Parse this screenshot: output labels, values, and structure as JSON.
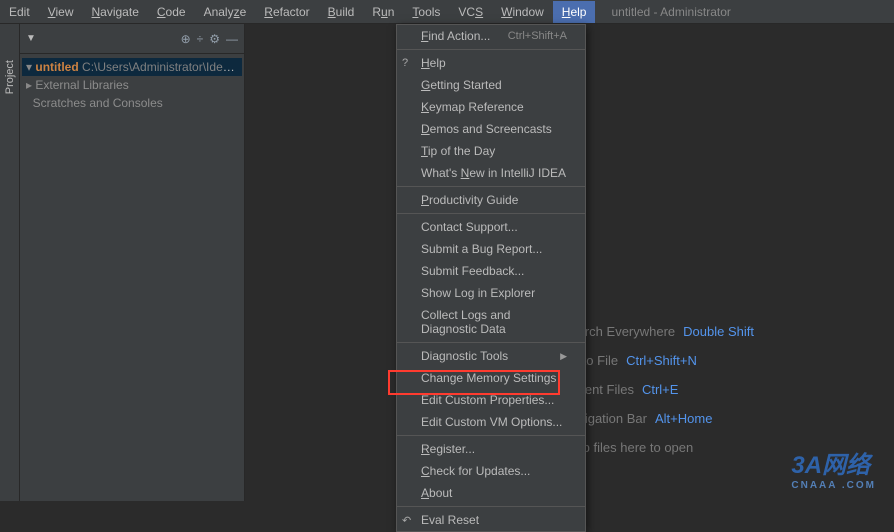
{
  "window_title": "untitled - Administrator",
  "menubar": {
    "edit": "Edit",
    "view": "View",
    "navigate": "Navigate",
    "code": "Code",
    "analyze": "Analyze",
    "refactor": "Refactor",
    "build": "Build",
    "run": "Run",
    "tools": "Tools",
    "vcs": "VCS",
    "window": "Window",
    "help": "Help"
  },
  "side_tab": "Project",
  "project": {
    "name": "untitled",
    "path": "C:\\Users\\Administrator\\IdeaProjects\\untitled",
    "ext_libs": "External Libraries",
    "scratches": "Scratches and Consoles"
  },
  "help_menu": {
    "find_action": "Find Action...",
    "find_action_sc": "Ctrl+Shift+A",
    "help": "Help",
    "getting_started": "Getting Started",
    "keymap_ref": "Keymap Reference",
    "demos": "Demos and Screencasts",
    "tip": "Tip of the Day",
    "whats_new": "What's New in IntelliJ IDEA",
    "productivity": "Productivity Guide",
    "contact": "Contact Support...",
    "bug": "Submit a Bug Report...",
    "feedback": "Submit Feedback...",
    "show_log": "Show Log in Explorer",
    "collect": "Collect Logs and Diagnostic Data",
    "diag_tools": "Diagnostic Tools",
    "memory": "Change Memory Settings",
    "custom_props": "Edit Custom Properties...",
    "custom_vm": "Edit Custom VM Options...",
    "register": "Register...",
    "updates": "Check for Updates...",
    "about": "About",
    "eval_reset": "Eval Reset"
  },
  "helper": {
    "search_lbl": "Search Everywhere",
    "search_sc": "Double Shift",
    "goto_lbl": "Go to File",
    "goto_sc": "Ctrl+Shift+N",
    "recent_lbl": "Recent Files",
    "recent_sc": "Ctrl+E",
    "nav_lbl": "Navigation Bar",
    "nav_sc": "Alt+Home",
    "drop": "Drop files here to open"
  },
  "watermark": {
    "main": "3A网络",
    "sub": "CNAAA .COM"
  }
}
